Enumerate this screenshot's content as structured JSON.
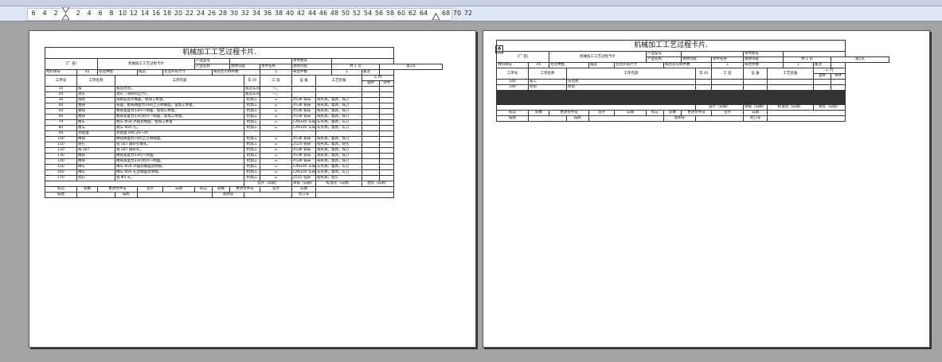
{
  "ruler": {
    "ticks": [
      "6",
      "4",
      "2",
      "2",
      "4",
      "6",
      "8",
      "10",
      "12",
      "14",
      "16",
      "18",
      "20",
      "22",
      "24",
      "26",
      "28",
      "30",
      "32",
      "34",
      "36",
      "38",
      "40",
      "42",
      "44",
      "46",
      "48",
      "50",
      "52",
      "54",
      "56",
      "58",
      "60",
      "62",
      "64",
      "68",
      "70",
      "72"
    ]
  },
  "page1": {
    "title": "机械加工工艺过程卡片.",
    "factory": "(厂 名)",
    "card_name": "机械加工工艺过程卡片",
    "labels": {
      "product_model": "产品型号",
      "part_drawing_no": "零件图号",
      "product_name": "产品名称",
      "part_name": "零件名称",
      "product_name_val": "驰骋舟艇",
      "part_name_val": "驰骋舟艇",
      "total_pages": "共 1 页",
      "page_no": "第1页",
      "material": "材料牌号",
      "material_val": "45",
      "blank_type": "毛坯种类",
      "blank_type_val": "锻造",
      "blank_size": "毛坯外形尺寸",
      "per_blank": "每毛坯可制件数",
      "per_blank_val": "1",
      "per_unit": "每台件数",
      "per_unit_val": "1",
      "remark": "备注",
      "op_no": "工序号",
      "op_name": "工序名称",
      "op_content": "工序内容",
      "workshop": "车 间",
      "section": "工 段",
      "equipment": "设 备",
      "tooling": "工艺装备",
      "hours": "工 时",
      "prep": "准终",
      "unit": "单件"
    },
    "rows": [
      [
        "10",
        "锻",
        "锻造毛坯。",
        "锻造车间。",
        "一。",
        "",
        ""
      ],
      [
        "20",
        "退火",
        "退火（消除内应力）。",
        "锻造车间。",
        "一。",
        "",
        ""
      ],
      [
        "30",
        "铣削",
        "铣削前后大端面，留加工余量。",
        "机加工",
        "三",
        "X53K 铣床",
        "铣夹具，量具，铣刀"
      ],
      [
        "40",
        "粗铣",
        "铣面，粗铣两面为14的上方侧端面，留加工余量。",
        "机加工",
        "三",
        "X53K 铣床",
        "铣夹具，量具，铣刀"
      ],
      [
        "50",
        "粗铣",
        "粗铣宽度为33的一侧面，留加工余量。",
        "机加工",
        "三",
        "X53K 铣床",
        "铣夹具，量具，铣刀"
      ],
      [
        "60",
        "粗铣",
        "粗铣宽度为33的另外一侧面，留加工余量。",
        "机加工",
        "三",
        "X53K 铣床",
        "铣夹具，量具，铣刀"
      ],
      [
        "70",
        "粗车",
        "粗车 Φ34 外圆及端面，留加工余量",
        "机加工",
        "三",
        "CA6140 车床",
        "车夹具，量具，车刀"
      ],
      [
        "80",
        "粗车",
        "粗车 Φ26 孔。",
        "机加工",
        "三",
        "CA6140 车床",
        "车夹具，量具，车刀"
      ],
      [
        "90",
        "热处理",
        "热处理 HRC28~29",
        "",
        "",
        "",
        ""
      ],
      [
        "100",
        "精铣",
        "精铣两面为14的上方侧端面。",
        "机加工",
        "三",
        "X53K 铣床",
        "铣夹具，量具，铣刀"
      ],
      [
        "110",
        "钻孔",
        "钻 Σ87 圆形孔端孔。",
        "机加工",
        "三",
        "Z525 钻床",
        "钻夹具，量具，钻头"
      ],
      [
        "120",
        "铣 Σ87",
        "铣 Σ87 圆形孔。",
        "机加工",
        "三",
        "X53K 铣床",
        "铣夹具，量具，铣刀"
      ],
      [
        "130",
        "精铣",
        "精铣宽度为33的一侧面。",
        "机加工",
        "三",
        "X53K 铣床",
        "铣夹具，量具，铣刀"
      ],
      [
        "140",
        "精铣",
        "精铣宽度为33的另外一侧面。",
        "机加工",
        "三",
        "X53K 铣床",
        "铣夹具，量具，铣刀"
      ],
      [
        "150",
        "精车",
        "精车 Φ34 外圆及端面及倒角。",
        "机加工",
        "三",
        "CA6140 车床",
        "车夹具，量具，车刀"
      ],
      [
        "160",
        "精车",
        "精车 Φ26 孔及端面及倒角。",
        "机加工",
        "三",
        "CA6140 车床",
        "车夹具，量具，车刀"
      ],
      [
        "170",
        "钻孔",
        "钻 Φ5 孔。",
        "机加工",
        "三",
        "Z525 钻床",
        "钻夹具，钻头"
      ]
    ],
    "footer": {
      "design": "设计（日期）",
      "review": "审核（日期）",
      "standard": "标准化（日期）",
      "sign": "会签（日期）",
      "mark": "标记",
      "count": "处数",
      "change_doc": "更改文件号",
      "signature": "签字",
      "date": "日期",
      "trace": "描图",
      "check": "描校",
      "base_no": "底图号",
      "bind_no": "装订号"
    }
  },
  "page2": {
    "title": "机械加工工艺过程卡片.",
    "rows": [
      [
        "180",
        "钳工",
        "去毛刺",
        "",
        "",
        "",
        ""
      ],
      [
        "190",
        "检验",
        "检验",
        "",
        "",
        "",
        ""
      ]
    ]
  }
}
